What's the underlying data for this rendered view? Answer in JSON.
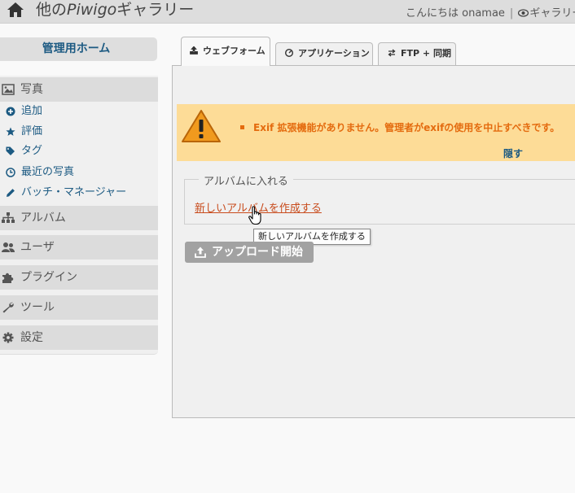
{
  "header": {
    "title_prefix": "他の",
    "title_brand": "Piwigo",
    "title_suffix": "ギャラリー",
    "greeting": "こんにちは onamae",
    "separator": "|",
    "gallery_link": "ギャラリー"
  },
  "sidebar": {
    "home": "管理用ホーム",
    "photos": {
      "label": "写真",
      "items": [
        {
          "label": "追加",
          "icon": "plus-circle-icon"
        },
        {
          "label": "評価",
          "icon": "star-icon"
        },
        {
          "label": "タグ",
          "icon": "tags-icon"
        },
        {
          "label": "最近の写真",
          "icon": "clock-icon"
        },
        {
          "label": "バッチ・マネージャー",
          "icon": "pencil-icon"
        }
      ]
    },
    "sections": [
      {
        "label": "アルバム",
        "icon": "sitemap-icon"
      },
      {
        "label": "ユーザ",
        "icon": "users-icon"
      },
      {
        "label": "プラグイン",
        "icon": "puzzle-icon"
      },
      {
        "label": "ツール",
        "icon": "wrench-icon"
      },
      {
        "label": "設定",
        "icon": "gear-icon"
      }
    ]
  },
  "tabs": [
    {
      "label": "ウェブフォーム",
      "active": true
    },
    {
      "label": "アプリケーション",
      "active": false
    },
    {
      "label": "FTP + 同期",
      "active": false
    }
  ],
  "warning": {
    "message": "Exif 拡張機能がありません。管理者がexifの使用を中止すべきです。",
    "hide": "隠す"
  },
  "album": {
    "legend": "アルバムに入れる",
    "create_link": "新しいアルバムを作成する",
    "tooltip": "新しいアルバムを作成する"
  },
  "upload": {
    "label": "アップロード開始"
  },
  "colors": {
    "link": "#1c5a82",
    "warning_bg": "#fddc97",
    "warning_text": "#e46b0f",
    "create_link": "#c84b1c"
  }
}
